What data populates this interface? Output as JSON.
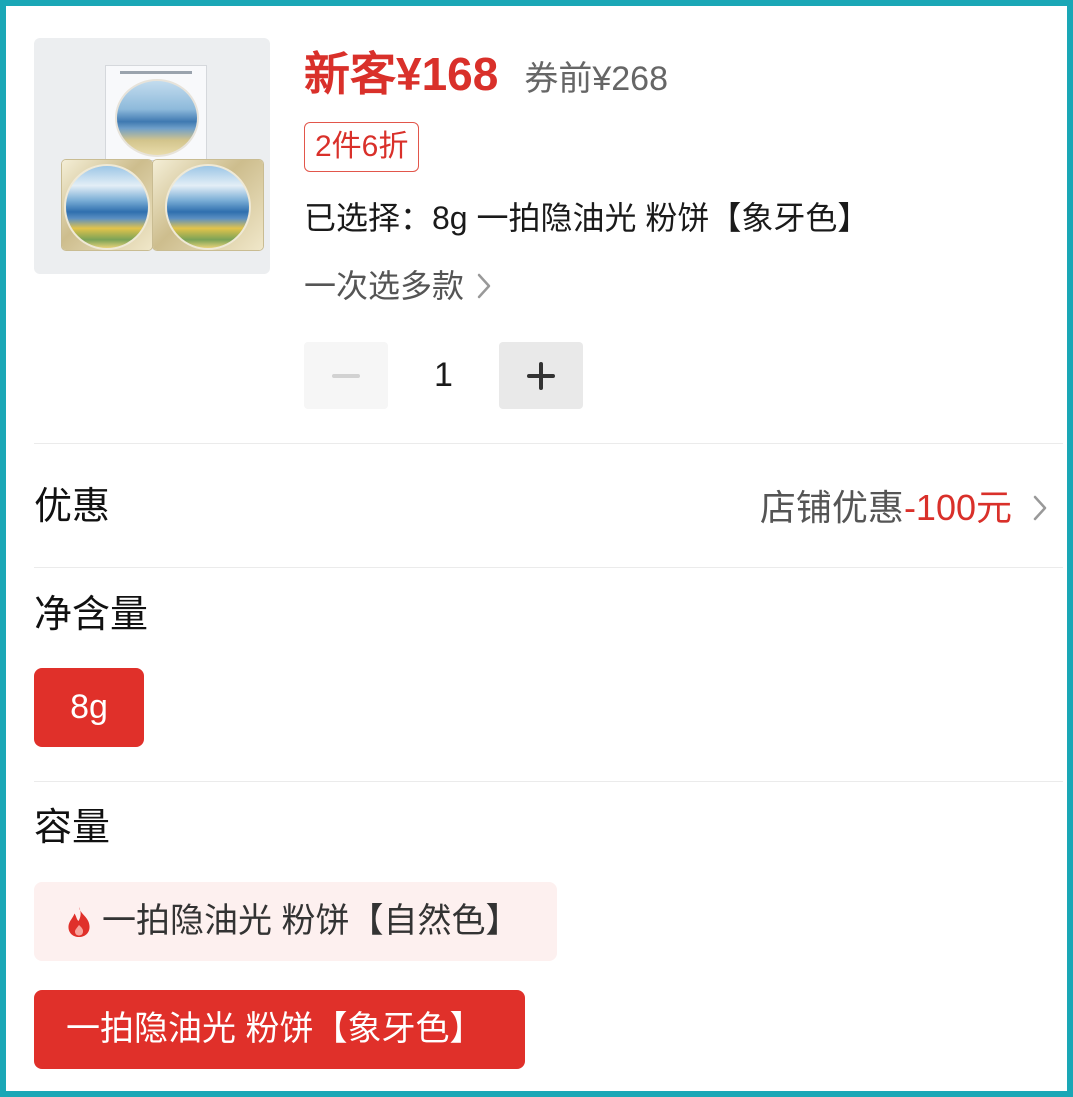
{
  "colors": {
    "frame": "#1aa7b6",
    "accent": "#e0302a",
    "hot_option_bg": "#fdf0ef",
    "muted_text": "#666666"
  },
  "product": {
    "image_icon": "compact-powder-product-photo",
    "price": "新客¥168",
    "original_price": "券前¥268",
    "promo_tag": "2件6折",
    "selected_summary": "已选择：8g 一拍隐油光 粉饼【象牙色】",
    "multi_select": {
      "label": "一次选多款",
      "icon": "chevron-right-icon"
    }
  },
  "quantity": {
    "decrement_icon": "minus-icon",
    "decrement_disabled": true,
    "value": "1",
    "increment_icon": "plus-icon"
  },
  "discount": {
    "label": "优惠",
    "type": "店铺优惠",
    "amount": "-100元",
    "icon": "chevron-right-icon"
  },
  "net_content": {
    "label": "净含量",
    "options": [
      {
        "label": "8g",
        "selected": true
      }
    ]
  },
  "capacity": {
    "label": "容量",
    "options": [
      {
        "label": "一拍隐油光 粉饼【自然色】",
        "icon": "flame-icon",
        "selected": false
      },
      {
        "label": "一拍隐油光 粉饼【象牙色】",
        "selected": true
      }
    ]
  }
}
